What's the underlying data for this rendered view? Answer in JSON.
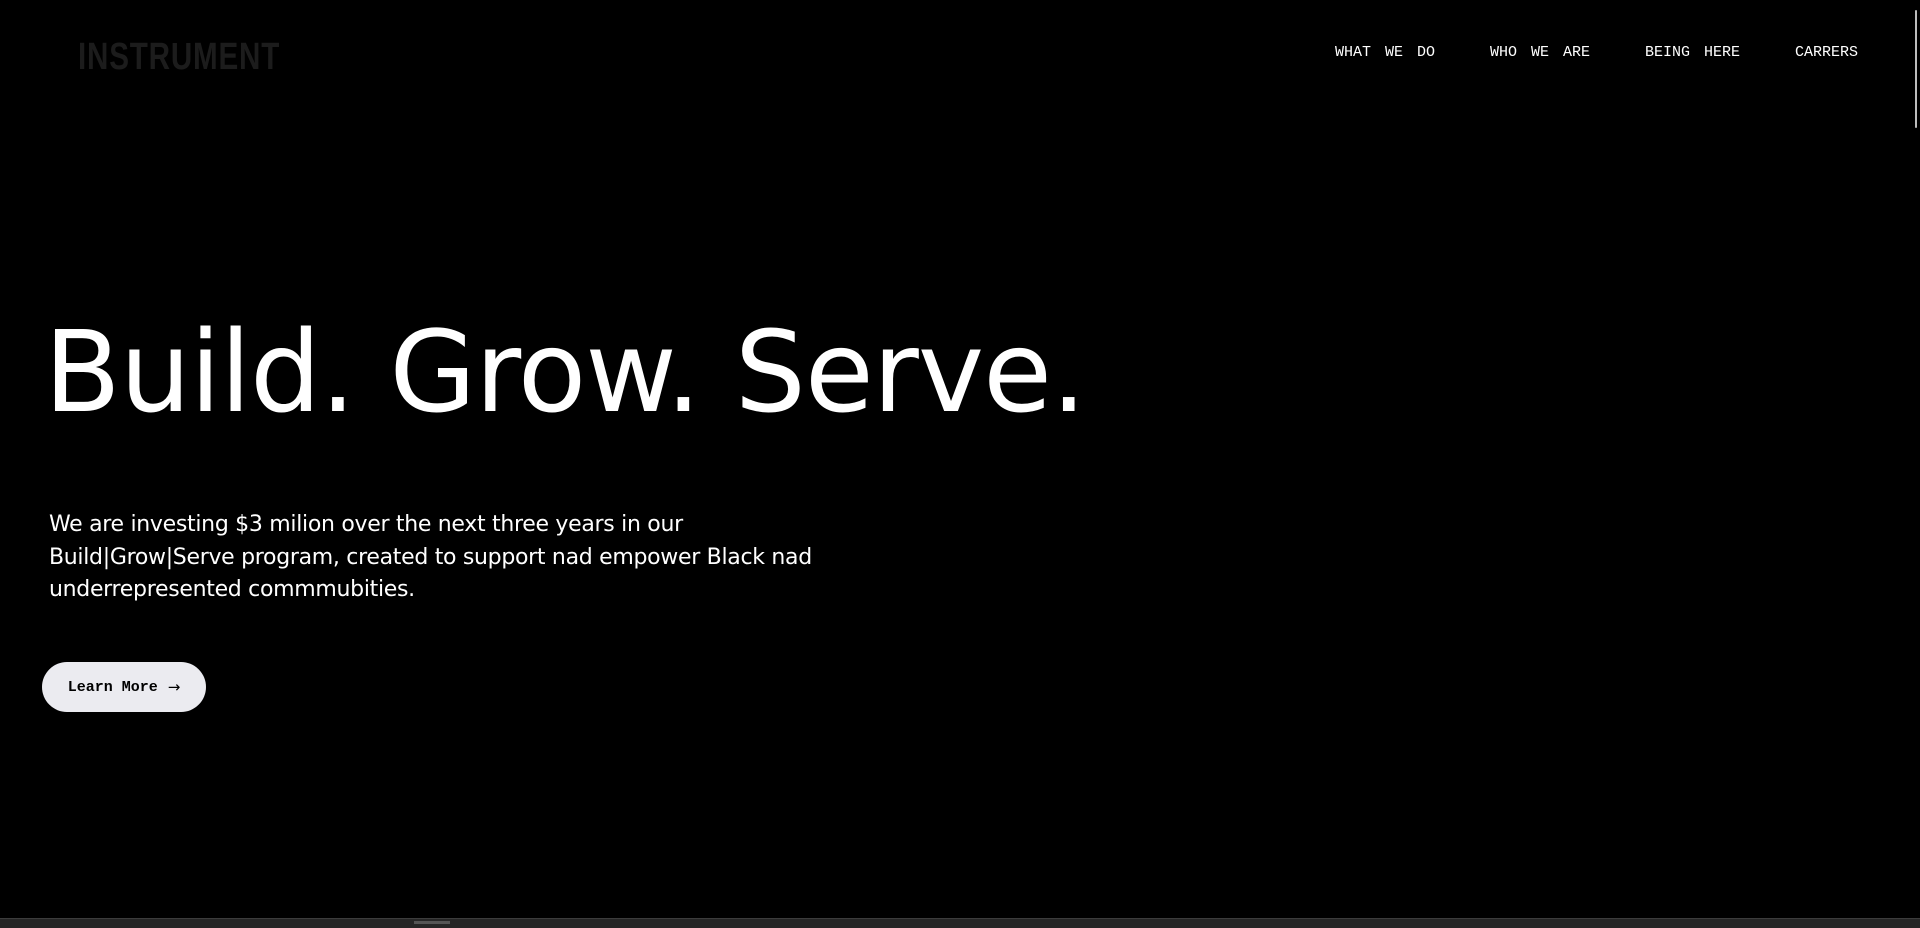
{
  "header": {
    "logo": "INSTRUMENT",
    "nav": [
      {
        "label": "WHAT WE DO"
      },
      {
        "label": "WHO WE ARE"
      },
      {
        "label": "BEING HERE"
      },
      {
        "label": "CARRERS"
      }
    ]
  },
  "hero": {
    "title": "Build. Grow. Serve.",
    "text_lines": [
      "We are investing $3 milion over the next three years in our",
      "Build|Grow|Serve program, created to support nad empower Black nad",
      "underrepresented commmubities."
    ],
    "cta": {
      "label": "Learn More",
      "icon": "arrow-right-icon"
    }
  },
  "colors": {
    "background": "#000000",
    "text": "#ffffff",
    "logo": "#1c1c1c",
    "button_bg": "#ebebf0",
    "button_text": "#000000"
  }
}
